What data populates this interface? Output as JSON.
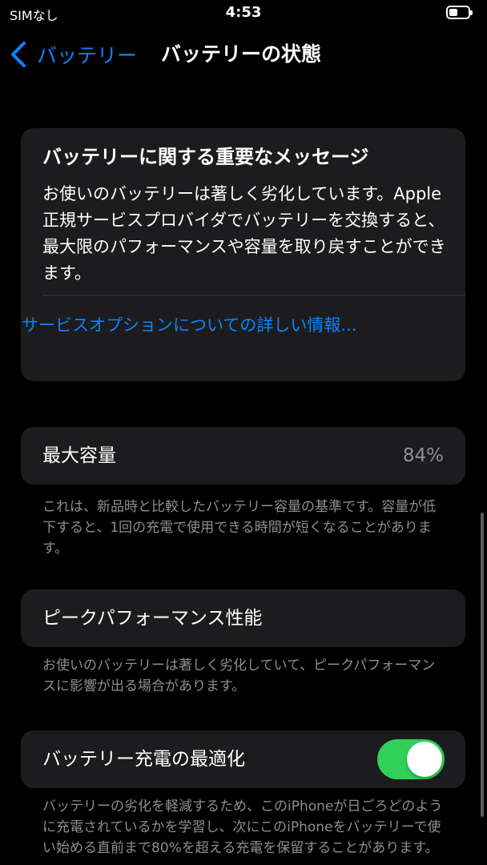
{
  "status_bar": {
    "carrier": "SIMなし",
    "time": "4:53",
    "battery_icon": "battery-low-icon"
  },
  "nav": {
    "back_label": "バッテリー",
    "back_icon": "chevron-left-icon",
    "title": "バッテリーの状態"
  },
  "message": {
    "title": "バッテリーに関する重要なメッセージ",
    "body": "お使いのバッテリーは著しく劣化しています。Apple正規サービスプロバイダでバッテリーを交換すると、最大限のパフォーマンスや容量を取り戻すことができます。",
    "link": "サービスオプションについての詳しい情報..."
  },
  "max_capacity": {
    "label": "最大容量",
    "value": "84%",
    "footnote": "これは、新品時と比較したバッテリー容量の基準です。容量が低下すると、1回の充電で使用できる時間が短くなることがあります。"
  },
  "peak_performance": {
    "label": "ピークパフォーマンス性能",
    "footnote": "お使いのバッテリーは著しく劣化していて、ピークパフォーマンスに影響が出る場合があります。"
  },
  "optimized_charging": {
    "label": "バッテリー充電の最適化",
    "enabled": true,
    "footnote": "バッテリーの劣化を軽減するため、このiPhoneが日ごろどのように充電されているかを学習し、次にこのiPhoneをバッテリーで使い始める直前まで80%を超える充電を保留することがあります。"
  },
  "colors": {
    "background": "#000000",
    "card": "#1c1c1e",
    "accent": "#0a84ff",
    "toggle_on": "#30d158",
    "secondary_text": "#8e8e93"
  }
}
